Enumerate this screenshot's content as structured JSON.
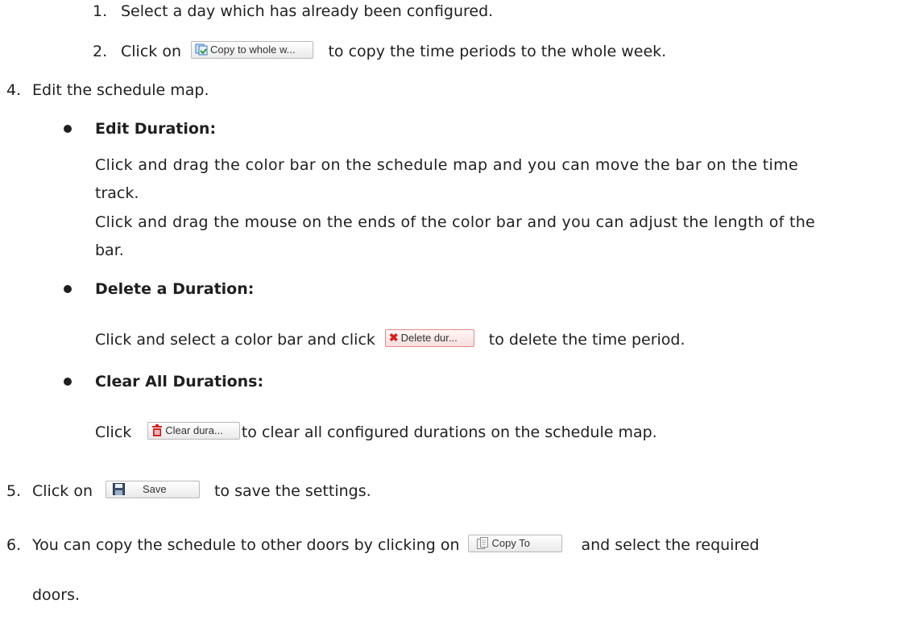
{
  "step1": {
    "num": "1.",
    "text": "Select a day which has already been configured."
  },
  "step2": {
    "num": "2.",
    "pre": "Click on",
    "button": "Copy to whole w...",
    "post": "to copy the time periods to the whole week."
  },
  "step4": {
    "num": "4.",
    "text": "Edit the schedule map."
  },
  "edit_duration": {
    "heading": "Edit Duration:",
    "p1_line1": "Click and drag the color bar on the schedule map and you can move the bar on the time",
    "p1_line2": "track.",
    "p2_line1": "Click and drag the mouse on the ends of the color bar and you can adjust the length of the",
    "p2_line2": "bar."
  },
  "delete_duration": {
    "heading": "Delete a Duration:",
    "pre": "Click and select a color bar and click",
    "button": "Delete dur...",
    "post": "to delete the time period."
  },
  "clear_durations": {
    "heading": "Clear All Durations:",
    "pre": "Click",
    "button": "Clear dura...",
    "post": "to clear all configured durations on the schedule map."
  },
  "step5": {
    "num": "5.",
    "pre": "Click on",
    "button": "Save",
    "post": "to save the settings."
  },
  "step6": {
    "num": "6.",
    "pre": "You can copy the schedule to other doors by clicking on",
    "button": "Copy To",
    "post": "and select the required",
    "line2": "doors."
  },
  "icons": {
    "copy_week": "copy-week-icon",
    "delete": "red-x-icon",
    "clear": "trash-icon",
    "save": "floppy-disk-icon",
    "copy_to": "document-copy-icon"
  }
}
